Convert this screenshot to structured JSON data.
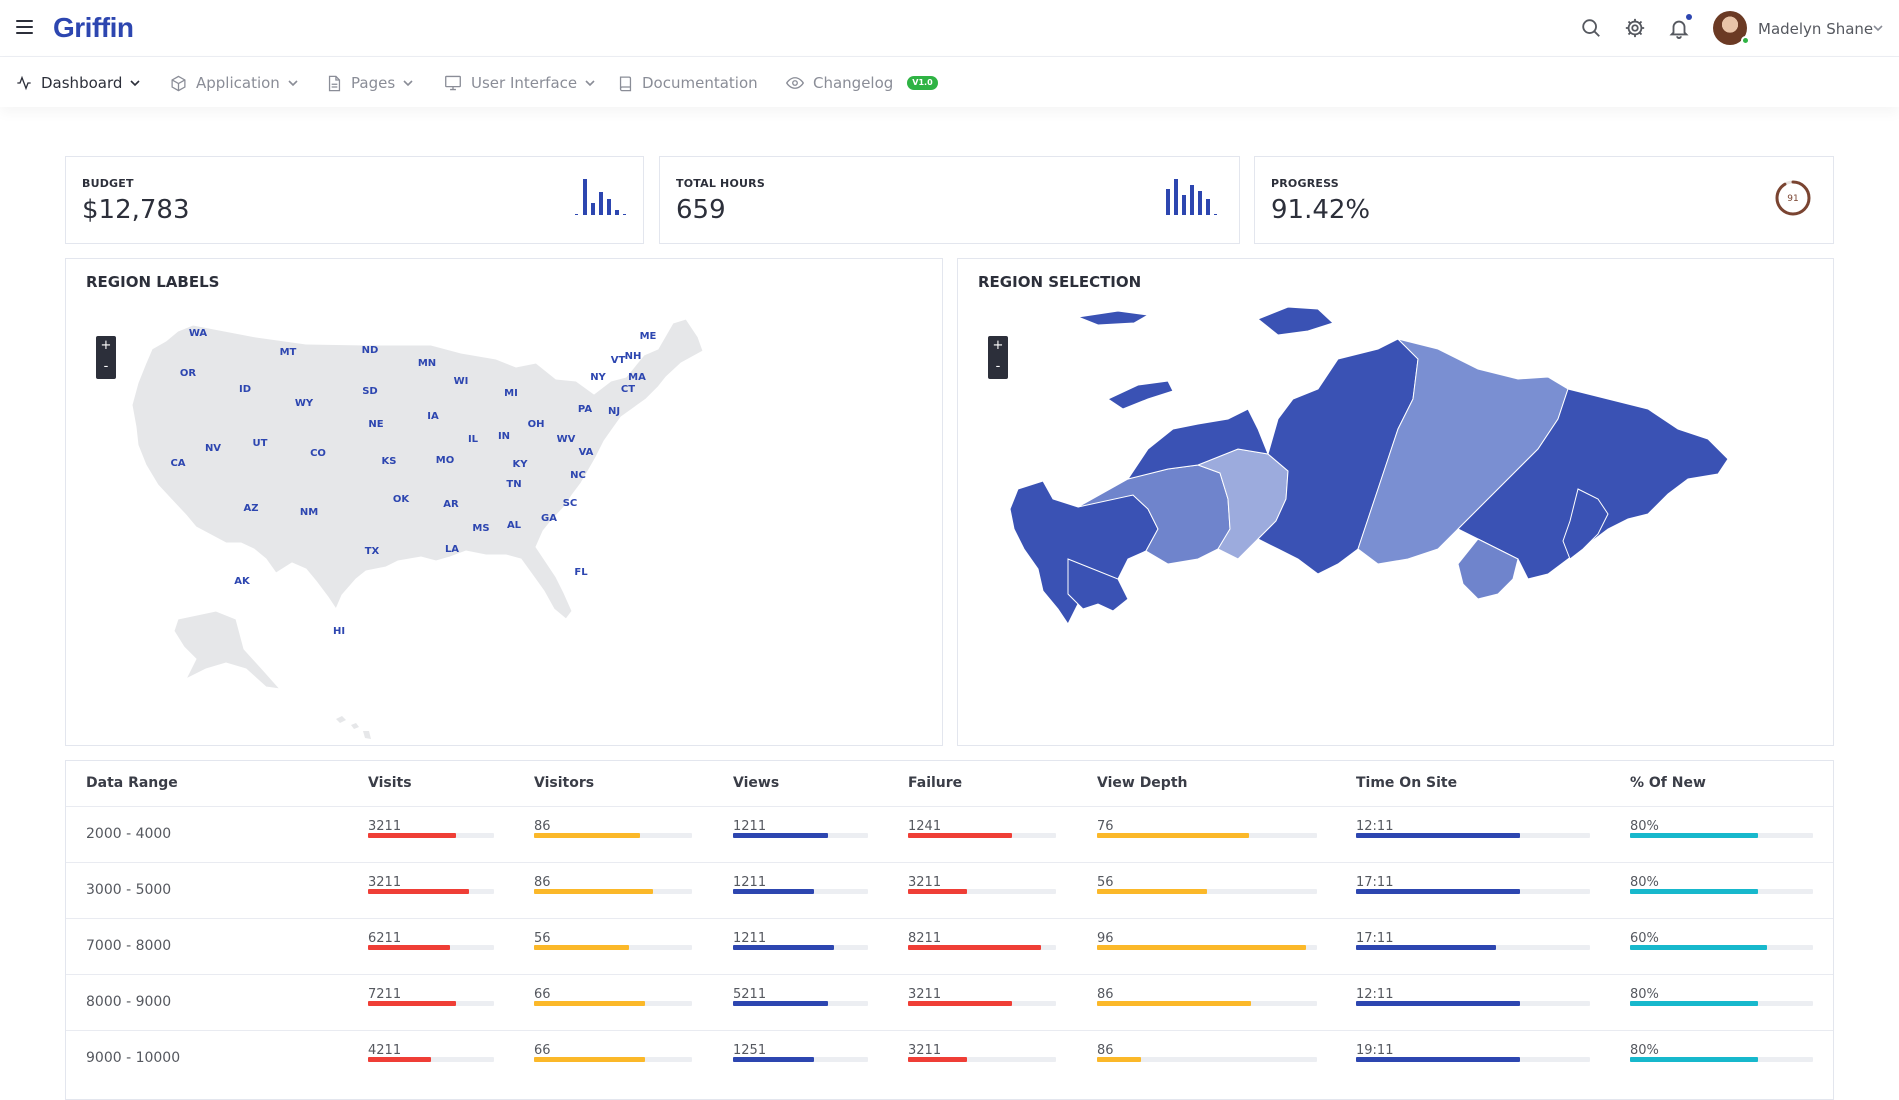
{
  "header": {
    "logo": "Griffin",
    "user_name": "Madelyn Shane"
  },
  "nav": {
    "items": [
      {
        "label": "Dashboard",
        "icon": "activity-icon",
        "has_caret": true
      },
      {
        "label": "Application",
        "icon": "box-icon",
        "has_caret": true
      },
      {
        "label": "Pages",
        "icon": "file-icon",
        "has_caret": true
      },
      {
        "label": "User Interface",
        "icon": "monitor-icon",
        "has_caret": true
      },
      {
        "label": "Documentation",
        "icon": "book-icon",
        "has_caret": false
      },
      {
        "label": "Changelog",
        "icon": "eye-icon",
        "has_caret": false,
        "badge": "V1.0"
      }
    ]
  },
  "stats": {
    "budget": {
      "label": "BUDGET",
      "value": "$12,783"
    },
    "hours": {
      "label": "TOTAL HOURS",
      "value": "659"
    },
    "progress": {
      "label": "PROGRESS",
      "value": "91.42%",
      "ring_value": "91",
      "ring_fraction": 0.9142
    }
  },
  "maps": {
    "left_title": "REGION LABELS",
    "right_title": "REGION SELECTION",
    "zoom_in": "+",
    "zoom_out": "-",
    "us_states": [
      "WA",
      "OR",
      "CA",
      "NV",
      "ID",
      "MT",
      "WY",
      "UT",
      "AZ",
      "CO",
      "NM",
      "ND",
      "SD",
      "NE",
      "KS",
      "OK",
      "TX",
      "MN",
      "IA",
      "MO",
      "AR",
      "LA",
      "WI",
      "IL",
      "MI",
      "IN",
      "OH",
      "KY",
      "TN",
      "MS",
      "AL",
      "GA",
      "FL",
      "SC",
      "NC",
      "VA",
      "WV",
      "PA",
      "NY",
      "VT",
      "NH",
      "ME",
      "MA",
      "CT",
      "NJ",
      "AK",
      "HI"
    ]
  },
  "table": {
    "headers": [
      "Data Range",
      "Visits",
      "Visitors",
      "Views",
      "Failure",
      "View Depth",
      "Time On Site",
      "% Of New"
    ],
    "colors": {
      "red": "#ef3e36",
      "yellow": "#fbb829",
      "blue": "#2d46b0",
      "teal": "#17b8cc"
    },
    "rows": [
      {
        "range": "2000 - 4000",
        "visits": "3211",
        "visitors": "86",
        "views": "1211",
        "failure": "1241",
        "depth": "76",
        "time": "12:11",
        "new": "80%",
        "fills": [
          0.7,
          0.67,
          0.7,
          0.7,
          0.69,
          0.7,
          0.7
        ]
      },
      {
        "range": "3000 - 5000",
        "visits": "3211",
        "visitors": "86",
        "views": "1211",
        "failure": "3211",
        "depth": "56",
        "time": "17:11",
        "new": "80%",
        "fills": [
          0.8,
          0.75,
          0.6,
          0.4,
          0.5,
          0.7,
          0.7
        ]
      },
      {
        "range": "7000 - 8000",
        "visits": "6211",
        "visitors": "56",
        "views": "1211",
        "failure": "8211",
        "depth": "96",
        "time": "17:11",
        "new": "60%",
        "fills": [
          0.65,
          0.6,
          0.75,
          0.9,
          0.95,
          0.6,
          0.75
        ]
      },
      {
        "range": "8000 - 9000",
        "visits": "7211",
        "visitors": "66",
        "views": "5211",
        "failure": "3211",
        "depth": "86",
        "time": "12:11",
        "new": "80%",
        "fills": [
          0.7,
          0.7,
          0.7,
          0.7,
          0.7,
          0.7,
          0.7
        ]
      },
      {
        "range": "9000 - 10000",
        "visits": "4211",
        "visitors": "66",
        "views": "1251",
        "failure": "3211",
        "depth": "86",
        "time": "19:11",
        "new": "80%",
        "fills": [
          0.5,
          0.7,
          0.6,
          0.4,
          0.2,
          0.7,
          0.7
        ]
      }
    ]
  }
}
